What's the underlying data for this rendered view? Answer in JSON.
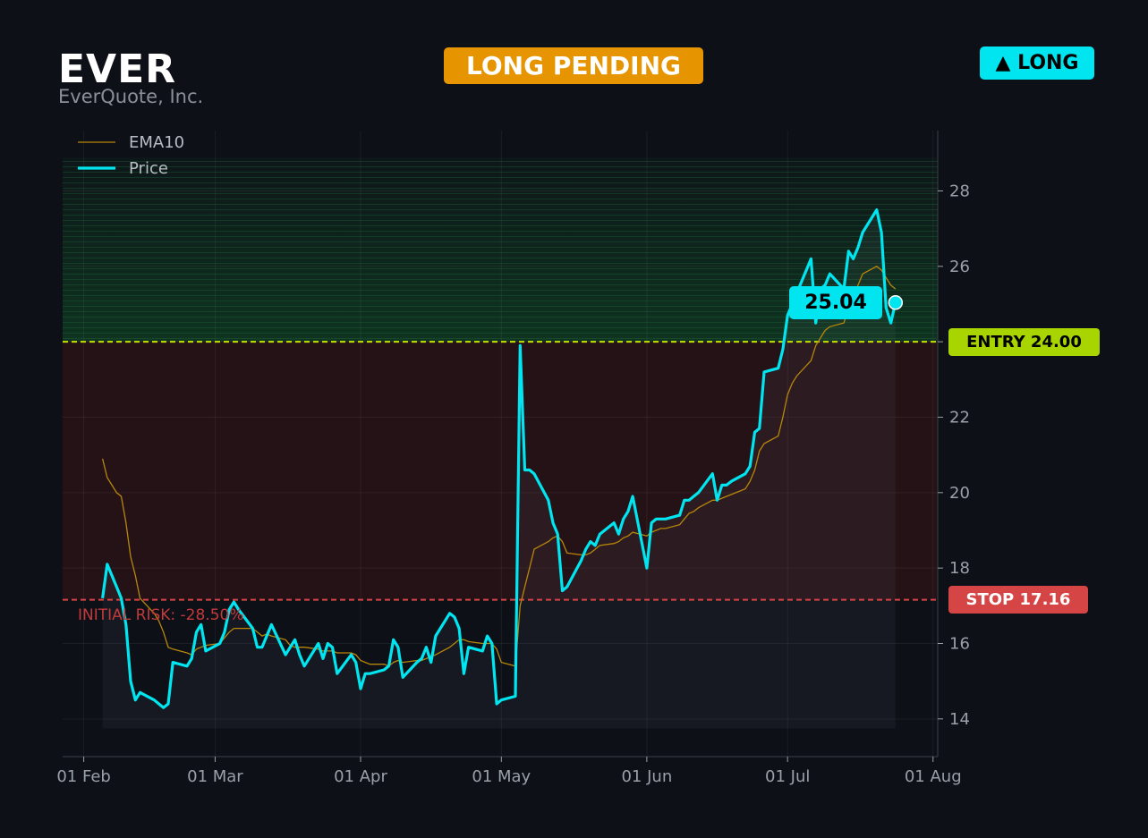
{
  "header": {
    "ticker": "EVER",
    "company": "EverQuote, Inc.",
    "status": "LONG PENDING",
    "direction": "▲ LONG"
  },
  "levels": {
    "entry_label": "ENTRY 24.00",
    "stop_label": "STOP 17.16",
    "risk_label": "INITIAL RISK: -28.50%",
    "price_label": "25.04"
  },
  "colors": {
    "background": "#0d1017",
    "price": "#00e5f0",
    "ema": "#b8860b",
    "entry": "#c8e000",
    "stop": "#d64545",
    "status": "#e69500",
    "reward_zone": "#0f3a22",
    "risk_zone": "#3a1418"
  },
  "chart_data": {
    "type": "line",
    "x_ticks": [
      "01 Feb",
      "01 Mar",
      "01 Apr",
      "01 May",
      "01 Jun",
      "01 Jul",
      "01 Aug"
    ],
    "x_tick_days": [
      0,
      28,
      59,
      89,
      120,
      150,
      181
    ],
    "xlim_days": [
      -4.5,
      182
    ],
    "y_ticks": [
      14,
      16,
      18,
      20,
      22,
      24,
      26,
      28
    ],
    "ylim": [
      13.0,
      29.6
    ],
    "grid": true,
    "legend": {
      "position": "top-left",
      "entries": [
        "EMA10",
        "Price"
      ]
    },
    "entry": 24.0,
    "stop": 17.16,
    "last_price": 25.04,
    "series": [
      {
        "name": "Price",
        "x": [
          4,
          5,
          6,
          7,
          8,
          9,
          10,
          11,
          12,
          15,
          16,
          17,
          18,
          19,
          22,
          23,
          24,
          25,
          26,
          29,
          30,
          31,
          32,
          33,
          36,
          37,
          38,
          39,
          40,
          43,
          44,
          45,
          46,
          47,
          50,
          51,
          52,
          53,
          54,
          57,
          58,
          59,
          60,
          61,
          64,
          65,
          66,
          67,
          68,
          71,
          72,
          73,
          74,
          75,
          78,
          79,
          80,
          81,
          82,
          85,
          86,
          87,
          88,
          89,
          92,
          93,
          94,
          95,
          96,
          99,
          100,
          101,
          102,
          103,
          106,
          107,
          108,
          109,
          110,
          113,
          114,
          115,
          116,
          117,
          120,
          121,
          122,
          123,
          124,
          127,
          128,
          129,
          130,
          131,
          134,
          135,
          136,
          137,
          138,
          141,
          142,
          143,
          144,
          145,
          148,
          149,
          150,
          151,
          152,
          155,
          156,
          157,
          158,
          159,
          162,
          163,
          164,
          165,
          166,
          169,
          170,
          171,
          172,
          173
        ],
        "y": [
          17.2,
          18.1,
          17.8,
          17.5,
          17.2,
          16.5,
          15.0,
          14.5,
          14.7,
          14.5,
          14.4,
          14.3,
          14.4,
          15.5,
          15.4,
          15.6,
          16.3,
          16.5,
          15.8,
          16.0,
          16.3,
          16.9,
          17.1,
          16.9,
          16.4,
          15.9,
          15.9,
          16.2,
          16.5,
          15.7,
          15.9,
          16.1,
          15.7,
          15.4,
          16.0,
          15.6,
          16.0,
          15.9,
          15.2,
          15.7,
          15.5,
          14.8,
          15.2,
          15.2,
          15.3,
          15.4,
          16.1,
          15.9,
          15.1,
          15.5,
          15.6,
          15.9,
          15.5,
          16.2,
          16.8,
          16.7,
          16.4,
          15.2,
          15.9,
          15.8,
          16.2,
          16.0,
          14.4,
          14.5,
          14.6,
          23.9,
          20.6,
          20.6,
          20.5,
          19.8,
          19.2,
          18.9,
          17.4,
          17.5,
          18.2,
          18.5,
          18.7,
          18.6,
          18.9,
          19.2,
          18.9,
          19.3,
          19.5,
          19.9,
          18.0,
          19.2,
          19.3,
          19.3,
          19.3,
          19.4,
          19.8,
          19.8,
          19.9,
          20.0,
          20.5,
          19.8,
          20.2,
          20.2,
          20.3,
          20.5,
          20.7,
          21.6,
          21.7,
          23.2,
          23.3,
          23.8,
          24.7,
          25.0,
          25.3,
          26.2,
          24.5,
          25.4,
          25.5,
          25.8,
          25.4,
          26.4,
          26.2,
          26.5,
          26.9,
          27.5,
          26.9,
          24.9,
          24.5,
          25.04
        ]
      },
      {
        "name": "EMA10",
        "x": [
          4,
          5,
          6,
          7,
          8,
          9,
          10,
          11,
          12,
          15,
          16,
          17,
          18,
          19,
          22,
          23,
          24,
          25,
          26,
          29,
          30,
          31,
          32,
          33,
          36,
          37,
          38,
          39,
          40,
          43,
          44,
          45,
          46,
          47,
          50,
          51,
          52,
          53,
          54,
          57,
          58,
          59,
          60,
          61,
          64,
          65,
          66,
          67,
          68,
          71,
          72,
          73,
          74,
          75,
          78,
          79,
          80,
          81,
          82,
          85,
          86,
          87,
          88,
          89,
          92,
          93,
          94,
          95,
          96,
          99,
          100,
          101,
          102,
          103,
          106,
          107,
          108,
          109,
          110,
          113,
          114,
          115,
          116,
          117,
          120,
          121,
          122,
          123,
          124,
          127,
          128,
          129,
          130,
          131,
          134,
          135,
          136,
          137,
          138,
          141,
          142,
          143,
          144,
          145,
          148,
          149,
          150,
          151,
          152,
          155,
          156,
          157,
          158,
          159,
          162,
          163,
          164,
          165,
          166,
          169,
          170,
          171,
          172,
          173
        ],
        "y": [
          20.9,
          20.4,
          20.2,
          20.0,
          19.9,
          19.2,
          18.3,
          17.8,
          17.2,
          16.8,
          16.6,
          16.3,
          15.9,
          15.85,
          15.75,
          15.7,
          15.85,
          15.9,
          15.95,
          16.0,
          16.15,
          16.3,
          16.4,
          16.4,
          16.4,
          16.3,
          16.2,
          16.25,
          16.2,
          16.1,
          15.95,
          15.9,
          15.9,
          15.9,
          15.85,
          15.8,
          15.8,
          15.8,
          15.75,
          15.75,
          15.7,
          15.55,
          15.5,
          15.45,
          15.45,
          15.4,
          15.5,
          15.55,
          15.5,
          15.55,
          15.55,
          15.6,
          15.65,
          15.7,
          15.9,
          16.0,
          16.1,
          16.1,
          16.05,
          16.0,
          16.0,
          16.0,
          15.85,
          15.5,
          15.4,
          17.0,
          17.5,
          18.0,
          18.5,
          18.7,
          18.8,
          18.85,
          18.7,
          18.4,
          18.35,
          18.35,
          18.4,
          18.5,
          18.6,
          18.65,
          18.7,
          18.8,
          18.85,
          18.95,
          18.85,
          18.95,
          19.0,
          19.05,
          19.05,
          19.15,
          19.3,
          19.45,
          19.5,
          19.6,
          19.8,
          19.8,
          19.85,
          19.9,
          19.95,
          20.1,
          20.3,
          20.6,
          21.1,
          21.3,
          21.5,
          22.0,
          22.6,
          22.9,
          23.1,
          23.5,
          23.9,
          24.1,
          24.3,
          24.4,
          24.5,
          24.9,
          25.2,
          25.5,
          25.8,
          26.0,
          25.9,
          25.7,
          25.5,
          25.4
        ]
      }
    ]
  }
}
